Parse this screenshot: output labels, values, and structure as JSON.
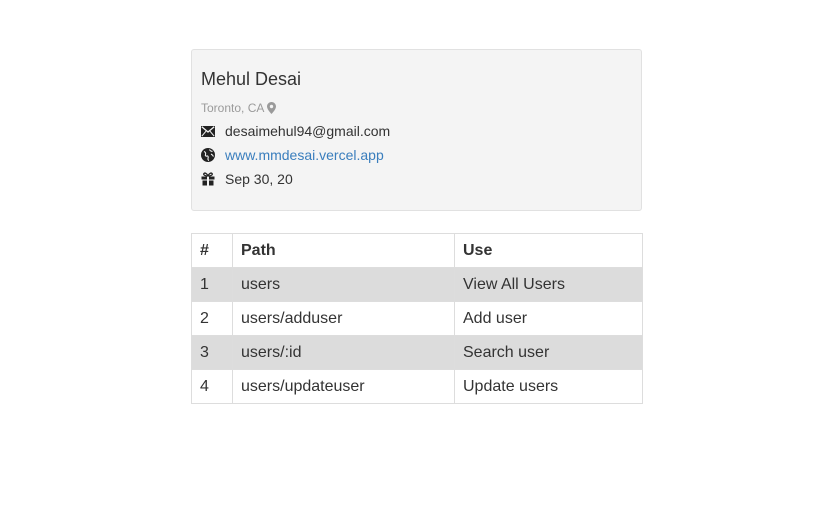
{
  "profile": {
    "name": "Mehul Desai",
    "location": "Toronto, CA",
    "email": "desaimehul94@gmail.com",
    "website": "www.mmdesai.vercel.app",
    "birthday": "Sep 30, 20"
  },
  "table": {
    "headers": [
      "#",
      "Path",
      "Use"
    ],
    "rows": [
      {
        "num": "1",
        "path": "users",
        "use": "View All Users"
      },
      {
        "num": "2",
        "path": "users/adduser",
        "use": "Add user"
      },
      {
        "num": "3",
        "path": "users/:id",
        "use": "Search user"
      },
      {
        "num": "4",
        "path": "users/updateuser",
        "use": "Update users"
      }
    ]
  },
  "colors": {
    "card_bg": "#f4f4f4",
    "link": "#3a7ebd",
    "stripe": "#dcdcdc",
    "muted": "#9a9a9a"
  },
  "icons": [
    "map-marker-icon",
    "envelope-icon",
    "globe-icon",
    "gift-icon"
  ]
}
